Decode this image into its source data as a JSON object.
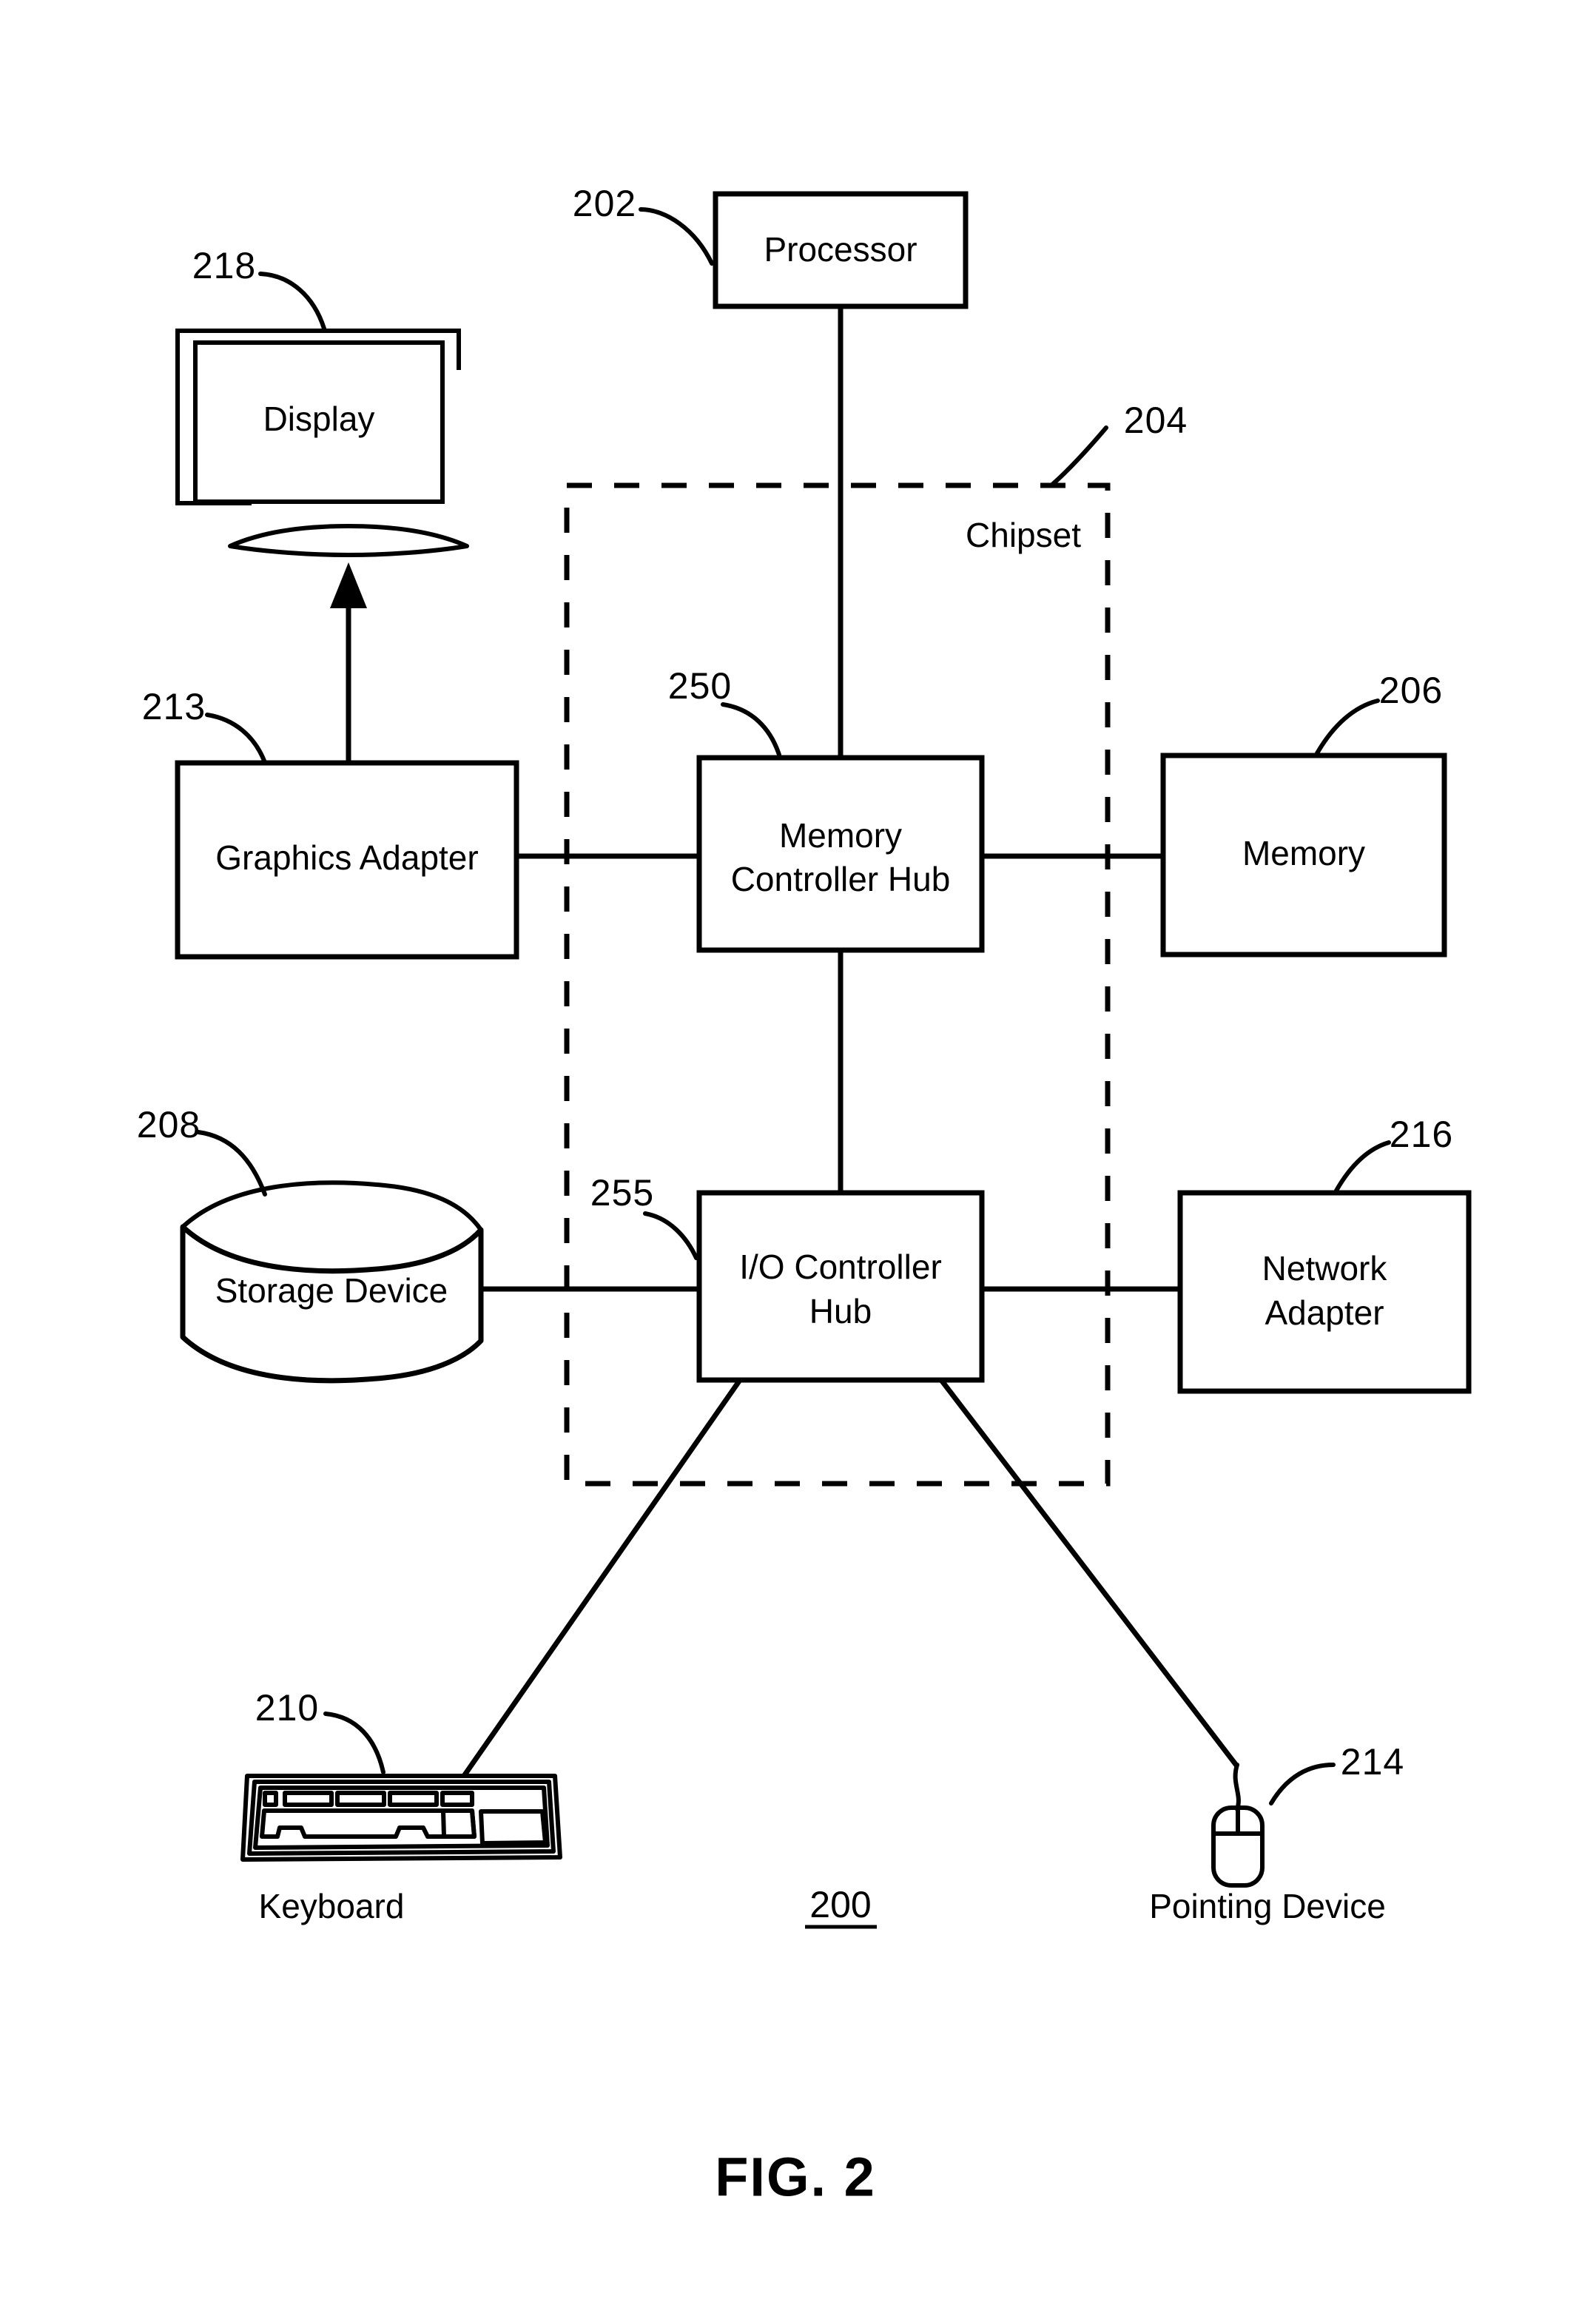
{
  "figure": {
    "title": "FIG. 2",
    "system_number": "200"
  },
  "blocks": {
    "processor": {
      "label": "Processor",
      "ref": "202"
    },
    "chipset": {
      "label": "Chipset",
      "ref": "204"
    },
    "memory_controller_hub": {
      "label_line1": "Memory",
      "label_line2": "Controller Hub",
      "ref": "250"
    },
    "memory": {
      "label": "Memory",
      "ref": "206"
    },
    "graphics_adapter": {
      "label": "Graphics Adapter",
      "ref": "213"
    },
    "display": {
      "label": "Display",
      "ref": "218"
    },
    "storage_device": {
      "label": "Storage Device",
      "ref": "208"
    },
    "io_controller_hub": {
      "label_line1": "I/O Controller",
      "label_line2": "Hub",
      "ref": "255"
    },
    "network_adapter": {
      "label_line1": "Network",
      "label_line2": "Adapter",
      "ref": "216"
    },
    "keyboard": {
      "label": "Keyboard",
      "ref": "210"
    },
    "pointing_device": {
      "label": "Pointing Device",
      "ref": "214"
    }
  },
  "colors": {
    "ink": "#000000",
    "paper": "#ffffff"
  }
}
